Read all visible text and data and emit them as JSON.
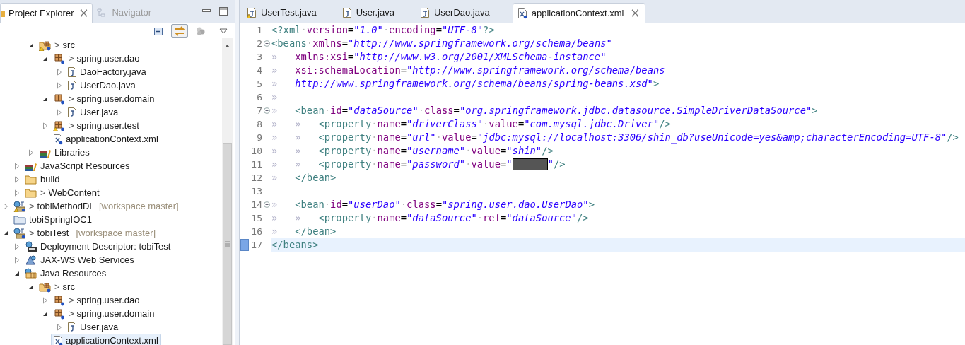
{
  "explorer": {
    "tabs": [
      {
        "label": "Project Explorer",
        "selected": true
      },
      {
        "label": "Navigator",
        "selected": false
      }
    ],
    "link_with_editor": true,
    "tree": [
      {
        "children": [
          {
            "children": [
              {
                "label": "src",
                "prefix": ">",
                "kind": "srcfolder-warn",
                "expanded": true,
                "selected": false,
                "children": [
                  {
                    "label": "spring.user.dao",
                    "prefix": ">",
                    "kind": "package",
                    "expanded": true,
                    "selected": false,
                    "children": [
                      {
                        "label": "DaoFactory.java",
                        "kind": "java",
                        "expanded": false,
                        "selected": false
                      },
                      {
                        "label": "UserDao.java",
                        "kind": "java",
                        "expanded": false,
                        "selected": false
                      }
                    ]
                  },
                  {
                    "label": "spring.user.domain",
                    "prefix": ">",
                    "kind": "package",
                    "expanded": true,
                    "selected": false,
                    "children": [
                      {
                        "label": "User.java",
                        "kind": "java",
                        "expanded": false,
                        "selected": false
                      }
                    ]
                  },
                  {
                    "label": "spring.user.test",
                    "prefix": ">",
                    "kind": "package-warn",
                    "expanded": false,
                    "selected": false
                  },
                  {
                    "label": "applicationContext.xml",
                    "kind": "xml",
                    "selected": false
                  }
                ]
              },
              {
                "label": "Libraries",
                "kind": "library",
                "expanded": false,
                "selected": false
              }
            ]
          },
          {
            "label": "JavaScript Resources",
            "kind": "library",
            "expanded": false,
            "selected": false
          },
          {
            "label": "build",
            "kind": "folder",
            "expanded": false,
            "selected": false
          },
          {
            "label": "WebContent",
            "prefix": ">",
            "kind": "folder",
            "expanded": false,
            "selected": false
          }
        ]
      },
      {
        "label": "tobiMethodDI",
        "prefix": ">",
        "decoration": "[workspace master]",
        "kind": "webproject-warn",
        "expanded": false,
        "selected": false
      },
      {
        "label": "tobiSpringIOC1",
        "kind": "project",
        "selected": false
      },
      {
        "label": "tobiTest",
        "prefix": ">",
        "decoration": "[workspace master]",
        "kind": "webproject",
        "expanded": true,
        "selected": false,
        "children": [
          {
            "label": "Deployment Descriptor: tobiTest",
            "kind": "descriptor",
            "expanded": false,
            "selected": false
          },
          {
            "label": "JAX-WS Web Services",
            "kind": "webservices",
            "expanded": false,
            "selected": false
          },
          {
            "label": "Java Resources",
            "kind": "javares",
            "expanded": true,
            "selected": false,
            "children": [
              {
                "label": "src",
                "prefix": ">",
                "kind": "srcfolder",
                "expanded": true,
                "selected": false,
                "children": [
                  {
                    "label": "spring.user.dao",
                    "prefix": ">",
                    "kind": "package",
                    "expanded": false,
                    "selected": false
                  },
                  {
                    "label": "spring.user.domain",
                    "prefix": ">",
                    "kind": "package",
                    "expanded": true,
                    "selected": false,
                    "children": [
                      {
                        "label": "User.java",
                        "kind": "java",
                        "expanded": false,
                        "selected": false
                      }
                    ]
                  },
                  {
                    "label": "applicationContext.xml",
                    "kind": "xml",
                    "selected": true
                  }
                ]
              }
            ]
          }
        ]
      }
    ]
  },
  "editor": {
    "tabs": [
      {
        "label": "UserTest.java",
        "kind": "java-warn",
        "selected": false
      },
      {
        "label": "User.java",
        "kind": "java",
        "selected": false
      },
      {
        "label": "UserDao.java",
        "kind": "java",
        "selected": false
      },
      {
        "label": "applicationContext.xml",
        "kind": "xml",
        "selected": true
      }
    ],
    "lines": [
      {
        "number": "1",
        "fold": false,
        "current": false,
        "tokens": [
          {
            "kind": "tag",
            "text": "<?xml"
          },
          {
            "kind": "dot",
            "text": "·"
          },
          {
            "kind": "attr",
            "text": "version"
          },
          {
            "kind": "eq",
            "text": "="
          },
          {
            "kind": "str",
            "text": "\"1.0\""
          },
          {
            "kind": "dot",
            "text": "·"
          },
          {
            "kind": "attr",
            "text": "encoding"
          },
          {
            "kind": "eq",
            "text": "="
          },
          {
            "kind": "str",
            "text": "\"UTF-8\""
          },
          {
            "kind": "tag",
            "text": "?>"
          }
        ]
      },
      {
        "number": "2",
        "fold": true,
        "current": false,
        "tokens": [
          {
            "kind": "tag",
            "text": "<beans"
          },
          {
            "kind": "dot",
            "text": "·"
          },
          {
            "kind": "attr",
            "text": "xmlns"
          },
          {
            "kind": "eq",
            "text": "="
          },
          {
            "kind": "str",
            "text": "\"http://www.springframework.org/schema/beans\""
          }
        ]
      },
      {
        "number": "3",
        "fold": false,
        "current": false,
        "tokens": [
          {
            "kind": "tab",
            "text": "»"
          },
          {
            "kind": "attr",
            "text": "xmlns:xsi"
          },
          {
            "kind": "eq",
            "text": "="
          },
          {
            "kind": "str",
            "text": "\"http://www.w3.org/2001/XMLSchema-instance\""
          }
        ]
      },
      {
        "number": "4",
        "fold": false,
        "current": false,
        "tokens": [
          {
            "kind": "tab",
            "text": "»"
          },
          {
            "kind": "attr",
            "text": "xsi:schemaLocation"
          },
          {
            "kind": "eq",
            "text": "="
          },
          {
            "kind": "str",
            "text": "\"http://www.springframework.org/schema/beans"
          }
        ]
      },
      {
        "number": "5",
        "fold": false,
        "current": false,
        "tokens": [
          {
            "kind": "tab",
            "text": "»"
          },
          {
            "kind": "str",
            "text": "http://www.springframework.org/schema/beans/spring-beans.xsd\""
          },
          {
            "kind": "tag",
            "text": ">"
          }
        ]
      },
      {
        "number": "6",
        "fold": false,
        "current": false,
        "tokens": [
          {
            "kind": "tab",
            "text": "»"
          }
        ]
      },
      {
        "number": "7",
        "fold": true,
        "current": false,
        "tokens": [
          {
            "kind": "tab",
            "text": "»"
          },
          {
            "kind": "tag",
            "text": "<bean"
          },
          {
            "kind": "dot",
            "text": "·"
          },
          {
            "kind": "attr",
            "text": "id"
          },
          {
            "kind": "eq",
            "text": "="
          },
          {
            "kind": "str",
            "text": "\"dataSource\""
          },
          {
            "kind": "dot",
            "text": "·"
          },
          {
            "kind": "attr",
            "text": "class"
          },
          {
            "kind": "eq",
            "text": "="
          },
          {
            "kind": "str",
            "text": "\"org.springframework.jdbc.datasource.SimpleDriverDataSource\""
          },
          {
            "kind": "tag",
            "text": ">"
          }
        ]
      },
      {
        "number": "8",
        "fold": false,
        "current": false,
        "tokens": [
          {
            "kind": "tab",
            "text": "»"
          },
          {
            "kind": "tab",
            "text": "»"
          },
          {
            "kind": "tag",
            "text": "<property"
          },
          {
            "kind": "dot",
            "text": "·"
          },
          {
            "kind": "attr",
            "text": "name"
          },
          {
            "kind": "eq",
            "text": "="
          },
          {
            "kind": "str",
            "text": "\"driverClass\""
          },
          {
            "kind": "dot",
            "text": "·"
          },
          {
            "kind": "attr",
            "text": "value"
          },
          {
            "kind": "eq",
            "text": "="
          },
          {
            "kind": "str",
            "text": "\"com.mysql.jdbc.Driver\""
          },
          {
            "kind": "tag",
            "text": "/>"
          }
        ]
      },
      {
        "number": "9",
        "fold": false,
        "current": false,
        "tokens": [
          {
            "kind": "tab",
            "text": "»"
          },
          {
            "kind": "tab",
            "text": "»"
          },
          {
            "kind": "tag",
            "text": "<property"
          },
          {
            "kind": "dot",
            "text": "·"
          },
          {
            "kind": "attr",
            "text": "name"
          },
          {
            "kind": "eq",
            "text": "="
          },
          {
            "kind": "str",
            "text": "\"url\""
          },
          {
            "kind": "dot",
            "text": "·"
          },
          {
            "kind": "attr",
            "text": "value"
          },
          {
            "kind": "eq",
            "text": "="
          },
          {
            "kind": "str",
            "text": "\"jdbc:mysql://localhost:3306/shin_db?useUnicode=yes&amp;characterEncoding=UTF-8\""
          },
          {
            "kind": "tag",
            "text": "/>"
          }
        ]
      },
      {
        "number": "10",
        "fold": false,
        "current": false,
        "tokens": [
          {
            "kind": "tab",
            "text": "»"
          },
          {
            "kind": "tab",
            "text": "»"
          },
          {
            "kind": "tag",
            "text": "<property"
          },
          {
            "kind": "dot",
            "text": "·"
          },
          {
            "kind": "attr",
            "text": "name"
          },
          {
            "kind": "eq",
            "text": "="
          },
          {
            "kind": "str",
            "text": "\"username\""
          },
          {
            "kind": "dot",
            "text": "·"
          },
          {
            "kind": "attr",
            "text": "value"
          },
          {
            "kind": "eq",
            "text": "="
          },
          {
            "kind": "str",
            "text": "\"shin\""
          },
          {
            "kind": "tag",
            "text": "/>"
          }
        ]
      },
      {
        "number": "11",
        "fold": false,
        "current": false,
        "tokens": [
          {
            "kind": "tab",
            "text": "»"
          },
          {
            "kind": "tab",
            "text": "»"
          },
          {
            "kind": "tag",
            "text": "<property"
          },
          {
            "kind": "dot",
            "text": "·"
          },
          {
            "kind": "attr",
            "text": "name"
          },
          {
            "kind": "eq",
            "text": "="
          },
          {
            "kind": "str",
            "text": "\"password\""
          },
          {
            "kind": "dot",
            "text": "·"
          },
          {
            "kind": "attr",
            "text": "value"
          },
          {
            "kind": "eq",
            "text": "="
          },
          {
            "kind": "str",
            "text": "\""
          },
          {
            "kind": "hidden"
          },
          {
            "kind": "str",
            "text": "\""
          },
          {
            "kind": "tag",
            "text": "/>"
          }
        ]
      },
      {
        "number": "12",
        "fold": false,
        "current": false,
        "tokens": [
          {
            "kind": "tab",
            "text": "»"
          },
          {
            "kind": "tag",
            "text": "</bean>"
          }
        ]
      },
      {
        "number": "13",
        "fold": false,
        "current": false
      },
      {
        "number": "14",
        "fold": true,
        "current": false,
        "tokens": [
          {
            "kind": "tab",
            "text": "»"
          },
          {
            "kind": "tag",
            "text": "<bean"
          },
          {
            "kind": "dot",
            "text": "·"
          },
          {
            "kind": "attr",
            "text": "id"
          },
          {
            "kind": "eq",
            "text": "="
          },
          {
            "kind": "str",
            "text": "\"userDao\""
          },
          {
            "kind": "dot",
            "text": "·"
          },
          {
            "kind": "attr",
            "text": "class"
          },
          {
            "kind": "eq",
            "text": "="
          },
          {
            "kind": "str",
            "text": "\"spring.user.dao.UserDao\""
          },
          {
            "kind": "tag",
            "text": ">"
          }
        ]
      },
      {
        "number": "15",
        "fold": false,
        "current": false,
        "tokens": [
          {
            "kind": "tab",
            "text": "»"
          },
          {
            "kind": "tab",
            "text": "»"
          },
          {
            "kind": "tag",
            "text": "<property"
          },
          {
            "kind": "dot",
            "text": "·"
          },
          {
            "kind": "attr",
            "text": "name"
          },
          {
            "kind": "eq",
            "text": "="
          },
          {
            "kind": "str",
            "text": "\"dataSource\""
          },
          {
            "kind": "dot",
            "text": "·"
          },
          {
            "kind": "attr",
            "text": "ref"
          },
          {
            "kind": "eq",
            "text": "="
          },
          {
            "kind": "str",
            "text": "\"dataSource\""
          },
          {
            "kind": "tag",
            "text": "/>"
          }
        ]
      },
      {
        "number": "16",
        "fold": false,
        "current": false,
        "tokens": [
          {
            "kind": "tab",
            "text": "»"
          },
          {
            "kind": "tag",
            "text": "</bean>"
          }
        ]
      },
      {
        "number": "17",
        "fold": false,
        "current": true,
        "tokens": [
          {
            "kind": "tag",
            "text": "</beans>"
          }
        ]
      }
    ]
  }
}
